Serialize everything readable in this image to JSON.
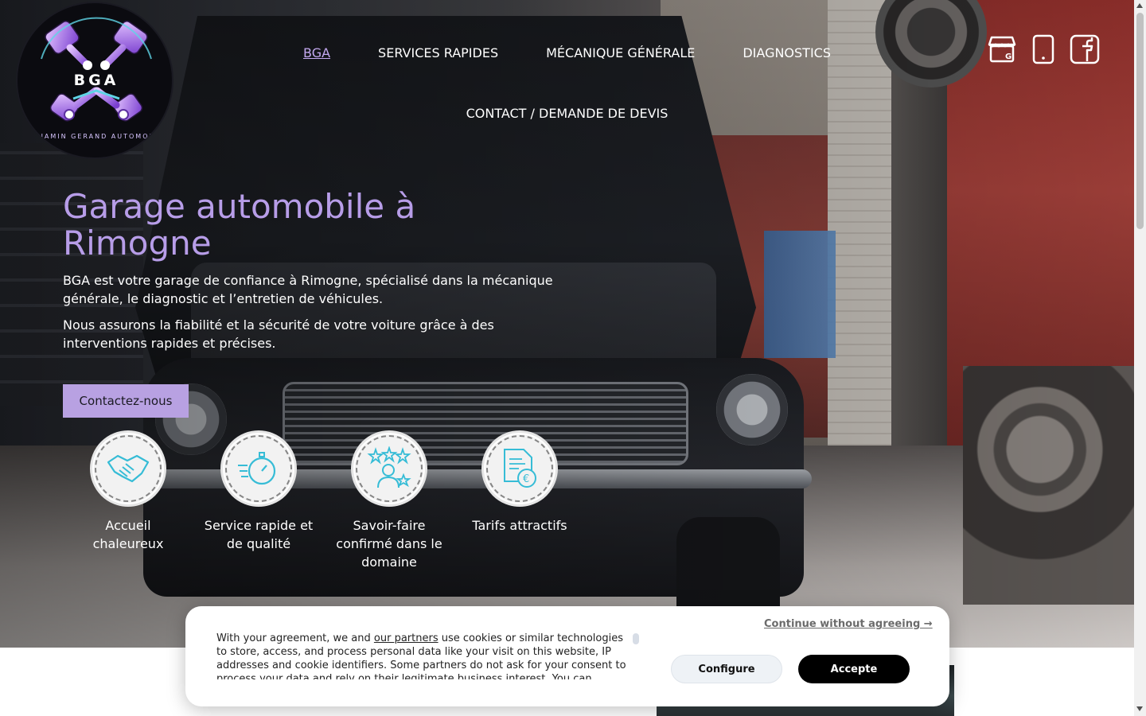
{
  "brand": {
    "logo_text": "BGA",
    "logo_ring_text": "BENJAMIN GERAND AUTOMOBILE",
    "accent": "#b8a1e2",
    "title_color": "#b79de8"
  },
  "nav": {
    "items": [
      {
        "label": "BGA",
        "active": true
      },
      {
        "label": "SERVICES RAPIDES"
      },
      {
        "label": "MÉCANIQUE GÉNÉRALE"
      },
      {
        "label": "DIAGNOSTICS"
      },
      {
        "label": "CONTACT / DEMANDE DE DEVIS"
      }
    ]
  },
  "social": {
    "icons": [
      "google-business-icon",
      "phone-icon",
      "facebook-icon"
    ]
  },
  "hero": {
    "title": "Garage automobile à Rimogne",
    "paragraph1": "BGA est votre garage de confiance à Rimogne, spécialisé dans la mécanique générale, le diagnostic et l’entretien de véhicules.",
    "paragraph2": "Nous assurons la fiabilité et la sécurité de votre voiture grâce à des interventions rapides et précises.",
    "cta_label": "Contactez-nous"
  },
  "features": [
    {
      "label": "Accueil chaleureux",
      "icon": "handshake-icon"
    },
    {
      "label": "Service rapide et de qualité",
      "icon": "stopwatch-icon"
    },
    {
      "label": "Savoir-faire confirmé dans le domaine",
      "icon": "expert-stars-icon"
    },
    {
      "label": "Tarifs attractifs",
      "icon": "euro-document-icon"
    }
  ],
  "cookie": {
    "text_before_link": "With your agreement, we and ",
    "link_text": "our partners",
    "text_after_link": " use cookies or similar technologies to store, access, and process personal data like your visit on this website, IP addresses and cookie identifiers. Some partners do not ask for your consent to process your data and rely on their legitimate business interest. You can",
    "continue_label": "Continue without agreeing →",
    "configure_label": "Configure",
    "accept_label": "Accepte"
  }
}
